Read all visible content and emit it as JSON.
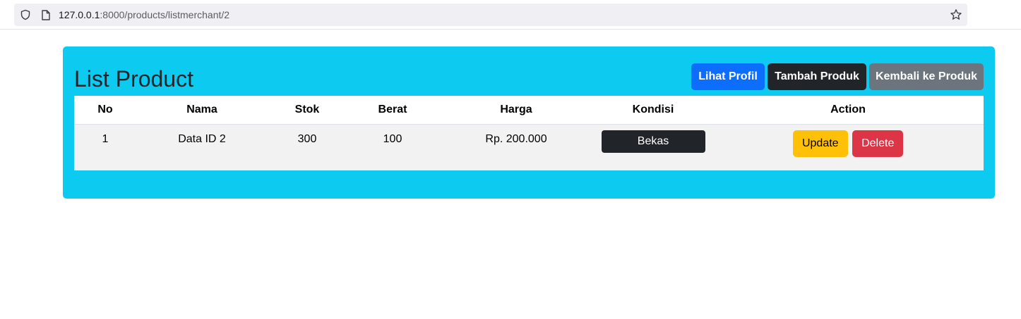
{
  "browser": {
    "url_host": "127.0.0.1",
    "url_rest": ":8000/products/listmerchant/2",
    "icons": [
      "shield-icon",
      "page-icon",
      "star-icon"
    ]
  },
  "page": {
    "title": "List Product",
    "buttons": {
      "lihat_profil": "Lihat Profil",
      "tambah_produk": "Tambah Produk",
      "kembali": "Kembali ke Produk"
    },
    "colors": {
      "panel": "#0dcaf0",
      "primary": "#0d6efd",
      "dark": "#212529",
      "secondary": "#6c757d",
      "warning": "#ffc107",
      "danger": "#dc3545"
    }
  },
  "table": {
    "headers": [
      "No",
      "Nama",
      "Stok",
      "Berat",
      "Harga",
      "Kondisi",
      "Action"
    ],
    "rows": [
      {
        "no": "1",
        "nama": "Data ID 2",
        "stok": "300",
        "berat": "100",
        "harga": "Rp. 200.000",
        "kondisi": "Bekas",
        "update_label": "Update",
        "delete_label": "Delete"
      }
    ]
  }
}
